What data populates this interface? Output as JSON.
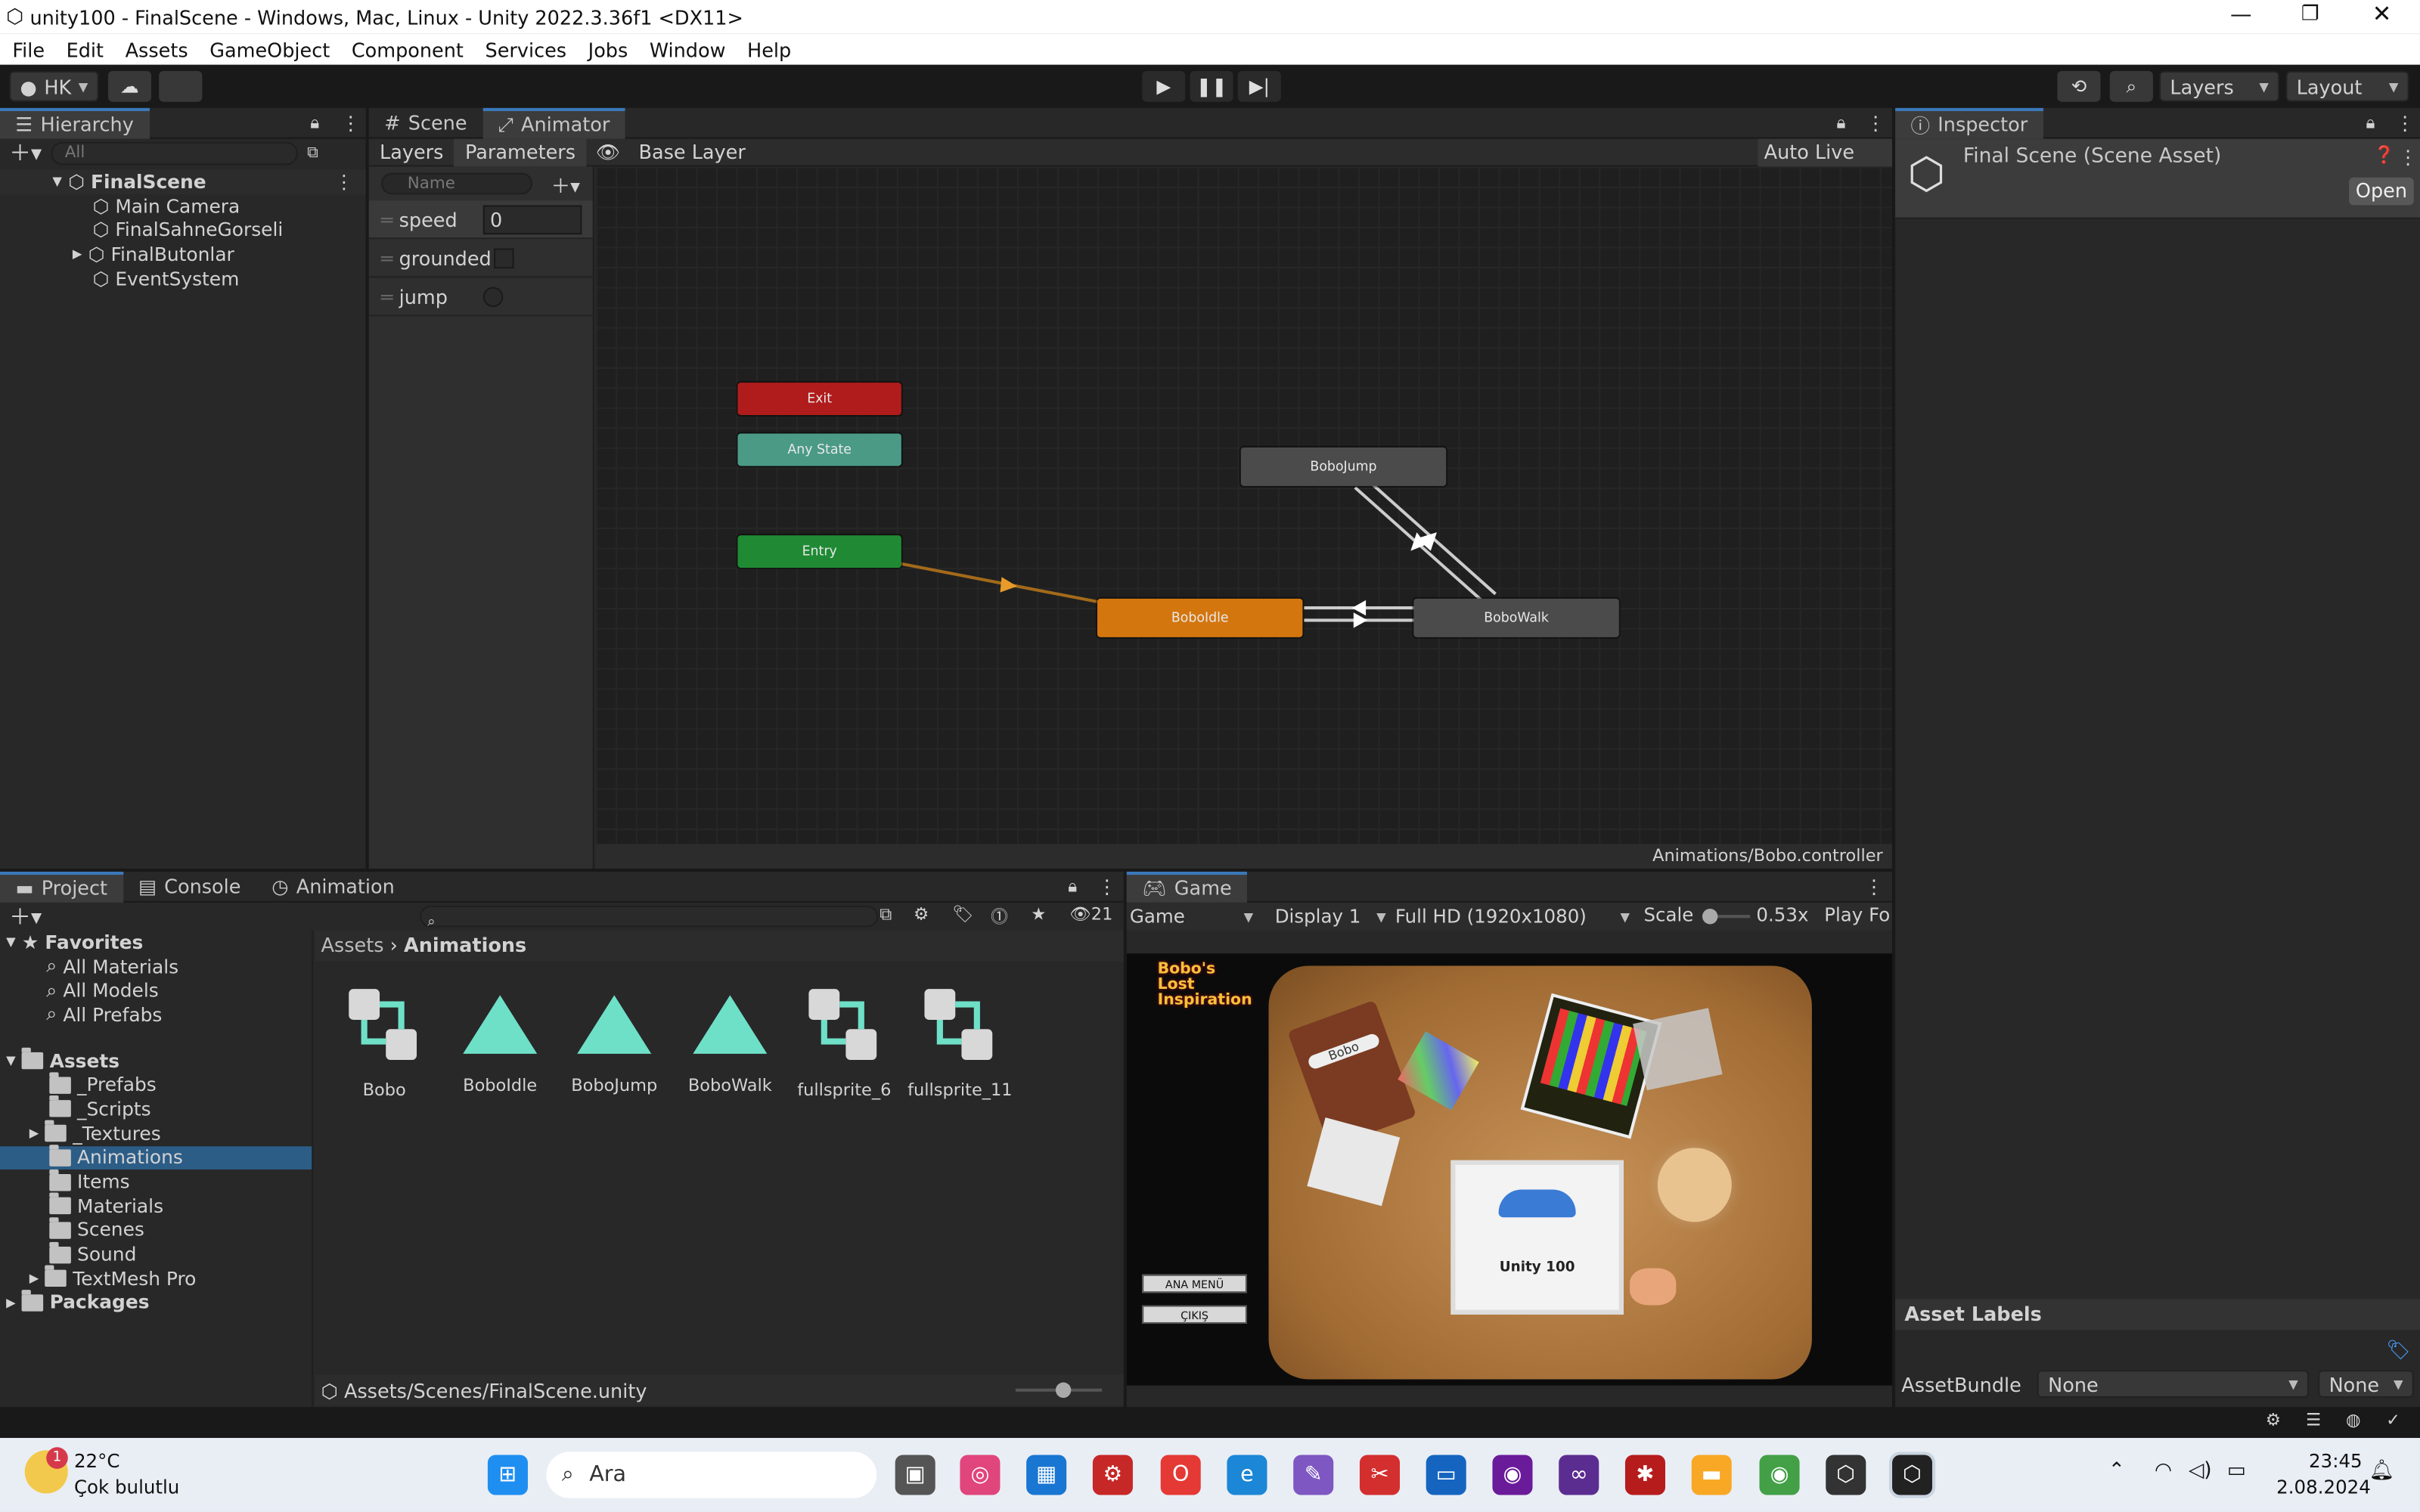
{
  "window": {
    "title": "unity100 - FinalScene - Windows, Mac, Linux - Unity 2022.3.36f1 <DX11>"
  },
  "menu": [
    "File",
    "Edit",
    "Assets",
    "GameObject",
    "Component",
    "Services",
    "Jobs",
    "Window",
    "Help"
  ],
  "toolbar": {
    "account": "HK",
    "layers": "Layers",
    "layout": "Layout"
  },
  "hierarchy": {
    "tab": "Hierarchy",
    "search_placeholder": "All",
    "scene": "FinalScene",
    "items": [
      "Main Camera",
      "FinalSahneGorseli",
      "FinalButonlar",
      "EventSystem"
    ]
  },
  "center_tabs": [
    "Scene",
    "Animator"
  ],
  "animator": {
    "subtabs": [
      "Layers",
      "Parameters"
    ],
    "breadcrumb": "Base Layer",
    "auto_live_link": "Auto Live Link",
    "search_placeholder": "Name",
    "params": [
      {
        "name": "speed",
        "value": "0",
        "type": "float"
      },
      {
        "name": "grounded",
        "type": "bool"
      },
      {
        "name": "jump",
        "type": "trigger"
      }
    ],
    "states": {
      "exit": "Exit",
      "any": "Any State",
      "entry": "Entry",
      "jump": "BoboJump",
      "idle": "BoboIdle",
      "walk": "BoboWalk"
    },
    "footer": "Animations/Bobo.controller"
  },
  "inspector": {
    "tab": "Inspector",
    "title": "Final Scene (Scene Asset)",
    "open": "Open",
    "asset_labels": "Asset Labels",
    "assetbundle_label": "AssetBundle",
    "bundle": "None",
    "variant": "None"
  },
  "project": {
    "tabs": [
      "Project",
      "Console",
      "Animation"
    ],
    "favorites": "Favorites",
    "fav_items": [
      "All Materials",
      "All Models",
      "All Prefabs"
    ],
    "assets": "Assets",
    "asset_folders": [
      "_Prefabs",
      "_Scripts",
      "_Textures",
      "Animations",
      "Items",
      "Materials",
      "Scenes",
      "Sound",
      "TextMesh Pro"
    ],
    "packages": "Packages",
    "breadcrumb": [
      "Assets",
      "Animations"
    ],
    "count": "21",
    "files": [
      "Bobo",
      "BoboIdle",
      "BoboJump",
      "BoboWalk",
      "fullsprite_6",
      "fullsprite_11"
    ],
    "footer": "Assets/Scenes/FinalScene.unity"
  },
  "game": {
    "tab": "Game",
    "mode": "Game",
    "display": "Display 1",
    "resolution": "Full HD (1920x1080)",
    "scale_label": "Scale",
    "scale": "0.53x",
    "play_focused": "Play Fo",
    "logo": "Bobo's Lost Inspiration",
    "btn_menu": "ANA MENÜ",
    "btn_exit": "ÇIKIŞ",
    "card_text": "Unity 100",
    "book_label": "Bobo"
  },
  "taskbar": {
    "temp": "22°C",
    "weather": "Çok bulutlu",
    "search": "Ara",
    "time": "23:45",
    "date": "2.08.2024",
    "badge": "1"
  }
}
